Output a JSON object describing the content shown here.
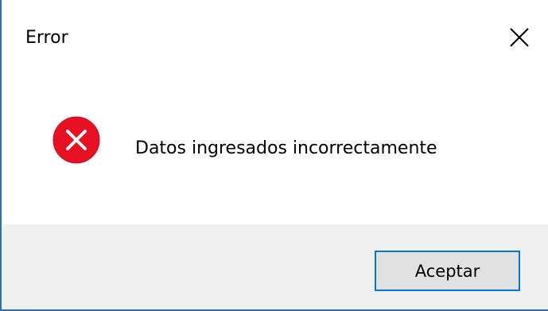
{
  "dialog": {
    "title": "Error",
    "close_icon": "close-icon",
    "message": "Datos ingresados incorrectamente",
    "error_icon": "error-icon",
    "ok_label": "Aceptar"
  },
  "colors": {
    "accent": "#0078d7",
    "error": "#e81123",
    "footer_bg": "#f0f0f0",
    "button_bg": "#e1e1e1"
  }
}
